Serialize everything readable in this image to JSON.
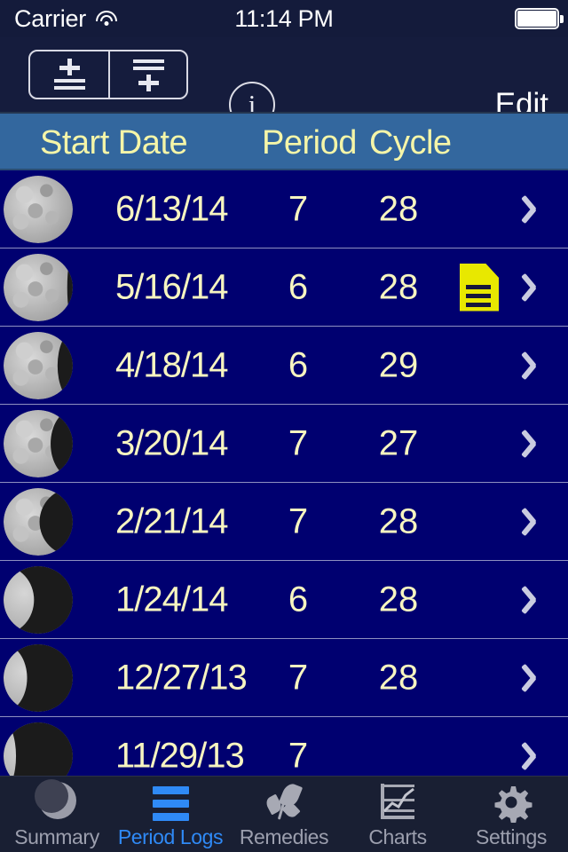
{
  "status_bar": {
    "carrier": "Carrier",
    "time": "11:14 PM",
    "wifi_icon": "wifi-icon",
    "battery_icon": "battery-full-icon"
  },
  "nav_bar": {
    "add_above_button": "add-entry-above",
    "add_below_button": "add-entry-below",
    "info_button_label": "i",
    "edit_button_label": "Edit"
  },
  "table": {
    "columns": {
      "start_date": "Start Date",
      "period": "Period",
      "cycle": "Cycle"
    },
    "rows": [
      {
        "moon_phase": "full-moon",
        "illumination": 100,
        "start_date": "6/13/14",
        "period": "7",
        "cycle": "28",
        "has_note": false
      },
      {
        "moon_phase": "waning-gibbous",
        "illumination": 92,
        "start_date": "5/16/14",
        "period": "6",
        "cycle": "28",
        "has_note": true
      },
      {
        "moon_phase": "waning-gibbous",
        "illumination": 78,
        "start_date": "4/18/14",
        "period": "6",
        "cycle": "29",
        "has_note": false
      },
      {
        "moon_phase": "waning-gibbous",
        "illumination": 68,
        "start_date": "3/20/14",
        "period": "7",
        "cycle": "27",
        "has_note": false
      },
      {
        "moon_phase": "last-quarter",
        "illumination": 52,
        "start_date": "2/21/14",
        "period": "7",
        "cycle": "28",
        "has_note": false
      },
      {
        "moon_phase": "last-quarter",
        "illumination": 44,
        "start_date": "1/24/14",
        "period": "6",
        "cycle": "28",
        "has_note": false
      },
      {
        "moon_phase": "waning-crescent",
        "illumination": 34,
        "start_date": "12/27/13",
        "period": "7",
        "cycle": "28",
        "has_note": false
      },
      {
        "moon_phase": "waning-crescent",
        "illumination": 18,
        "start_date": "11/29/13",
        "period": "7",
        "cycle": "",
        "has_note": false
      }
    ],
    "disclosure_icon": "chevron-right-icon",
    "note_icon": "note-document-icon"
  },
  "tab_bar": {
    "active_index": 1,
    "tabs": [
      {
        "label": "Summary",
        "icon": "moon-icon"
      },
      {
        "label": "Period Logs",
        "icon": "list-bars-icon"
      },
      {
        "label": "Remedies",
        "icon": "leaf-icon"
      },
      {
        "label": "Charts",
        "icon": "line-chart-icon"
      },
      {
        "label": "Settings",
        "icon": "gear-icon"
      }
    ]
  },
  "colors": {
    "list_background": "#000070",
    "header_background": "#33679E",
    "nav_background": "#151C3D",
    "tabbar_background": "#191F33",
    "accent_text": "#F7F5C0",
    "header_text": "#F5F5A8",
    "active_tab": "#2F8AF7",
    "note_yellow": "#E8E800"
  }
}
